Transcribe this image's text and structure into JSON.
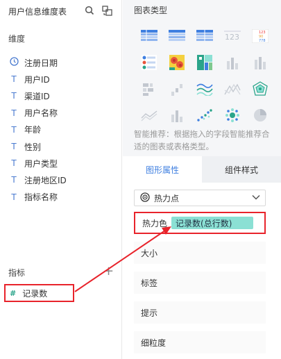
{
  "left": {
    "table_title": "用户信息维度表",
    "dimensions_title": "维度",
    "dimensions": [
      {
        "label": "注册日期",
        "icon": "clock-icon"
      },
      {
        "label": "用户ID",
        "icon": "text-type-icon"
      },
      {
        "label": "渠道ID",
        "icon": "text-type-icon"
      },
      {
        "label": "用户名称",
        "icon": "text-type-icon"
      },
      {
        "label": "年龄",
        "icon": "text-type-icon"
      },
      {
        "label": "性别",
        "icon": "text-type-icon"
      },
      {
        "label": "用户类型",
        "icon": "text-type-icon"
      },
      {
        "label": "注册地区ID",
        "icon": "text-type-icon"
      },
      {
        "label": "指标名称",
        "icon": "text-type-icon"
      }
    ],
    "measures_title": "指标",
    "measure": {
      "label": "记录数",
      "icon": "#"
    }
  },
  "right": {
    "chart_types_title": "图表类型",
    "hint": "智能推荐：根据拖入的字段智能推荐合适的图表或表格类型。",
    "tabs": [
      {
        "label": "图形属性",
        "active": true
      },
      {
        "label": "组件样式",
        "active": false
      }
    ],
    "select": {
      "value": "热力点"
    },
    "fields": [
      {
        "label": "热力色",
        "chip": "记录数(总行数)"
      },
      {
        "label": "大小"
      },
      {
        "label": "标签"
      },
      {
        "label": "提示"
      },
      {
        "label": "细粒度"
      }
    ]
  },
  "colors": {
    "accent": "#3f7fe0",
    "highlight": "#e8232b",
    "chip": "#8be0d4"
  }
}
